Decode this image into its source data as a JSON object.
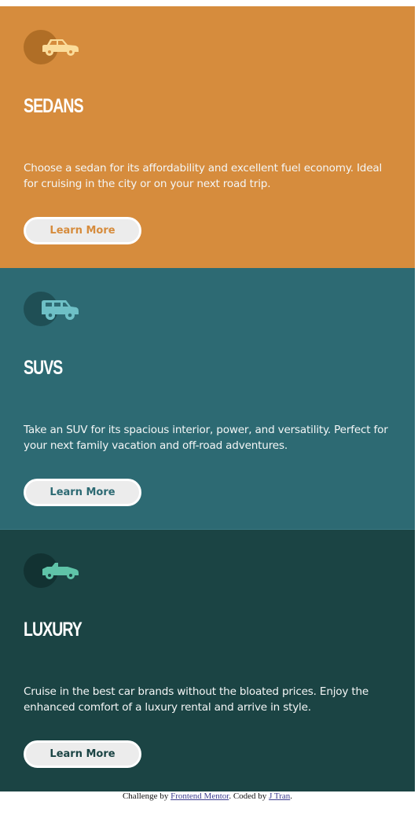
{
  "colors": {
    "sedans": "#d68c3d",
    "suvs": "#2d6a73",
    "luxury": "#1b4444",
    "button_bg": "#ececec",
    "text": "#ffffff"
  },
  "cards": [
    {
      "icon": "sedan-car-icon",
      "title": "SEDANS",
      "text": "Choose a sedan for its affordability and excellent fuel economy. Ideal for cruising in the city or on your next road trip.",
      "button_label": "Learn More"
    },
    {
      "icon": "suv-car-icon",
      "title": "SUVS",
      "text": "Take an SUV for its spacious interior, power, and versatility. Perfect for your next family vacation and off-road adventures.",
      "button_label": "Learn More"
    },
    {
      "icon": "luxury-car-icon",
      "title": "LUXURY",
      "text": "Cruise in the best car brands without the bloated prices. Enjoy the enhanced comfort of a luxury rental and arrive in style.",
      "button_label": "Learn More"
    }
  ],
  "attribution": {
    "prefix": "Challenge by ",
    "link1": "Frontend Mentor",
    "middle": ". Coded by ",
    "link2": "J Tran",
    "suffix": "."
  }
}
